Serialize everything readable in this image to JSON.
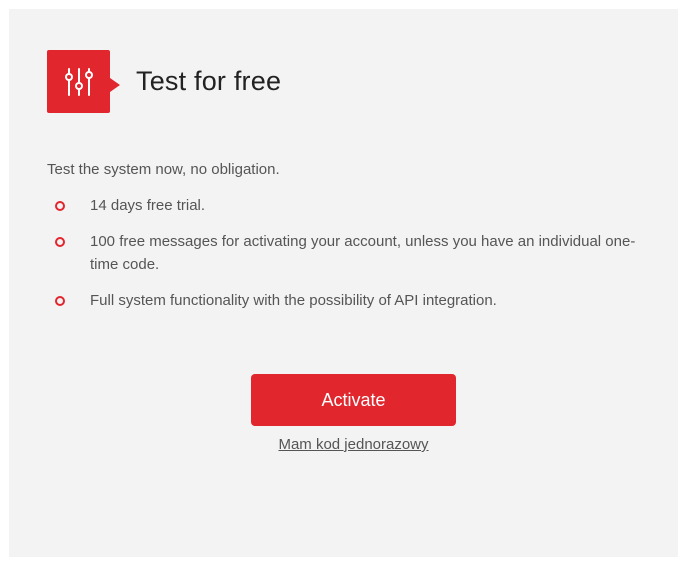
{
  "header": {
    "icon": "sliders-icon",
    "title": "Test for free"
  },
  "intro": "Test the system now, no obligation.",
  "features": [
    "14 days free trial.",
    "100 free messages for activating your account, unless you have an individual one-time code.",
    "Full system functionality with the possibility of API integration."
  ],
  "actions": {
    "activate_label": "Activate",
    "code_link_label": "Mam kod jednorazowy"
  },
  "colors": {
    "accent": "#e1262d",
    "card_background": "#f3f3f3",
    "body_text": "#555555",
    "title_text": "#222222"
  }
}
